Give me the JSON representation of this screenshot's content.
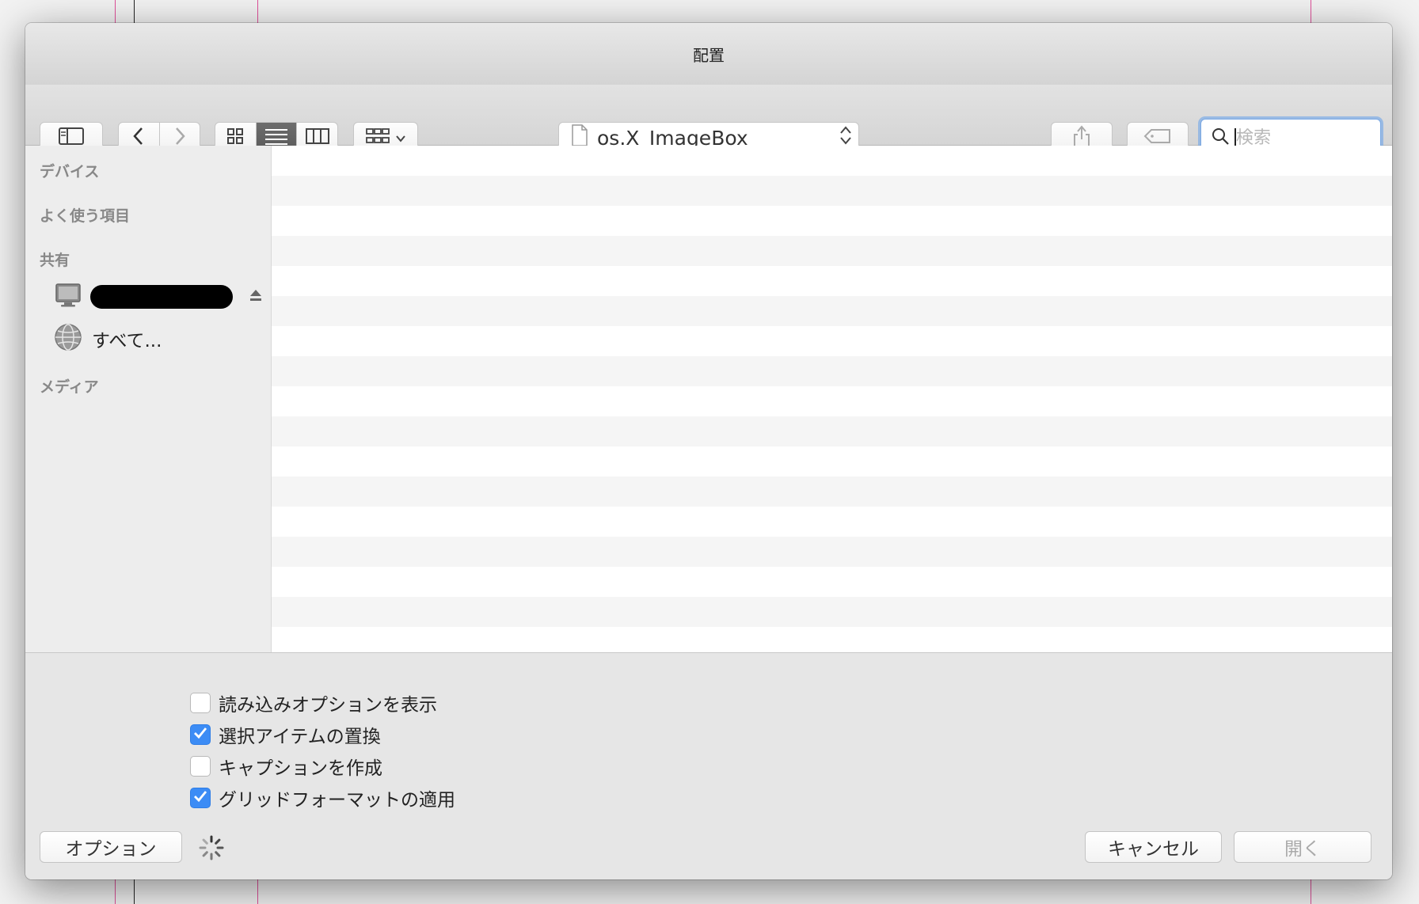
{
  "window": {
    "title": "配置"
  },
  "toolbar": {
    "path": {
      "folder_name": "os.X_ImageBox",
      "icon": "document-icon"
    },
    "search": {
      "placeholder": "検索",
      "value": ""
    },
    "view_mode": "list"
  },
  "sidebar": {
    "sections": {
      "devices": "デバイス",
      "favorites": "よく使う項目",
      "shared": "共有",
      "media": "メディア"
    },
    "shared_items": [
      {
        "label": "",
        "redacted": true,
        "icon": "computer-icon",
        "eject": true
      },
      {
        "label": "すべて...",
        "icon": "network-globe-icon"
      }
    ]
  },
  "options": [
    {
      "label": "読み込みオプションを表示",
      "checked": false
    },
    {
      "label": "選択アイテムの置換",
      "checked": true
    },
    {
      "label": "キャプションを作成",
      "checked": false
    },
    {
      "label": "グリッドフォーマットの適用",
      "checked": true
    }
  ],
  "footer": {
    "options_button": "オプション",
    "cancel_button": "キャンセル",
    "open_button": "開く",
    "open_enabled": false,
    "loading": true
  },
  "colors": {
    "accent": "#3c8cf5",
    "focus_ring": "#7aa8e3",
    "background_guides": "#e0509a"
  }
}
